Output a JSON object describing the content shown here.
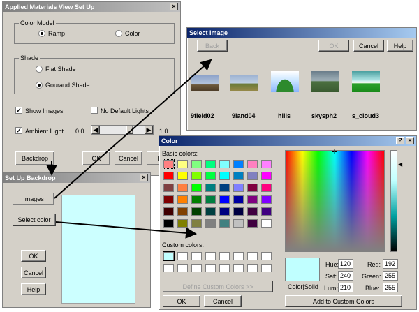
{
  "view_setup": {
    "title": "Applied Materials View Set Up",
    "color_model_label": "Color Model",
    "ramp_label": "Ramp",
    "color_label": "Color",
    "shade_label": "Shade",
    "flat_shade_label": "Flat Shade",
    "gouraud_shade_label": "Gouraud Shade",
    "show_images_label": "Show Images",
    "no_default_lights_label": "No Default Lights",
    "ambient_light_label": "Ambient Light",
    "ambient_min": "0.0",
    "ambient_max": "1.0",
    "backdrop_label": "Backdrop",
    "ok_label": "OK",
    "cancel_label": "Cancel",
    "help_label": "He"
  },
  "select_image": {
    "title": "Select Image",
    "back_label": "Back",
    "ok_label": "OK",
    "cancel_label": "Cancel",
    "help_label": "Help",
    "images": [
      {
        "name": "9field02"
      },
      {
        "name": "9land04"
      },
      {
        "name": "hills"
      },
      {
        "name": "skysph2"
      },
      {
        "name": "s_cloud3"
      }
    ]
  },
  "backdrop": {
    "title": "Set Up Backdrop",
    "images_label": "Images",
    "select_color_label": "Select color",
    "ok_label": "OK",
    "cancel_label": "Cancel",
    "help_label": "Help",
    "preview_color": "#ccffff"
  },
  "color_dialog": {
    "title": "Color",
    "basic_colors_label": "Basic colors:",
    "custom_colors_label": "Custom colors:",
    "define_custom_label": "Define Custom Colors >>",
    "ok_label": "OK",
    "cancel_label": "Cancel",
    "color_solid_label": "Color|Solid",
    "hue_label": "Hue:",
    "hue_value": "120",
    "sat_label": "Sat:",
    "sat_value": "240",
    "lum_label": "Lum:",
    "lum_value": "210",
    "red_label": "Red:",
    "red_value": "192",
    "green_label": "Green:",
    "green_value": "255",
    "blue_label": "Blue:",
    "blue_value": "255",
    "add_custom_label": "Add to Custom Colors",
    "basic_colors": [
      "#ff8080",
      "#ffff80",
      "#80ff80",
      "#00ff80",
      "#80ffff",
      "#0080ff",
      "#ff80c0",
      "#ff80ff",
      "#ff0000",
      "#ffff00",
      "#80ff00",
      "#00ff40",
      "#00ffff",
      "#0080c0",
      "#8080c0",
      "#ff00ff",
      "#804040",
      "#ff8040",
      "#00ff00",
      "#008080",
      "#004080",
      "#8080ff",
      "#800040",
      "#ff0080",
      "#800000",
      "#ff8000",
      "#008000",
      "#008040",
      "#0000ff",
      "#0000a0",
      "#800080",
      "#8000ff",
      "#400000",
      "#804000",
      "#004000",
      "#004040",
      "#000080",
      "#000040",
      "#400040",
      "#400080",
      "#000000",
      "#808000",
      "#808040",
      "#808080",
      "#408080",
      "#c0c0c0",
      "#400040",
      "#ffffff"
    ],
    "selected_color": "#c0ffff"
  }
}
